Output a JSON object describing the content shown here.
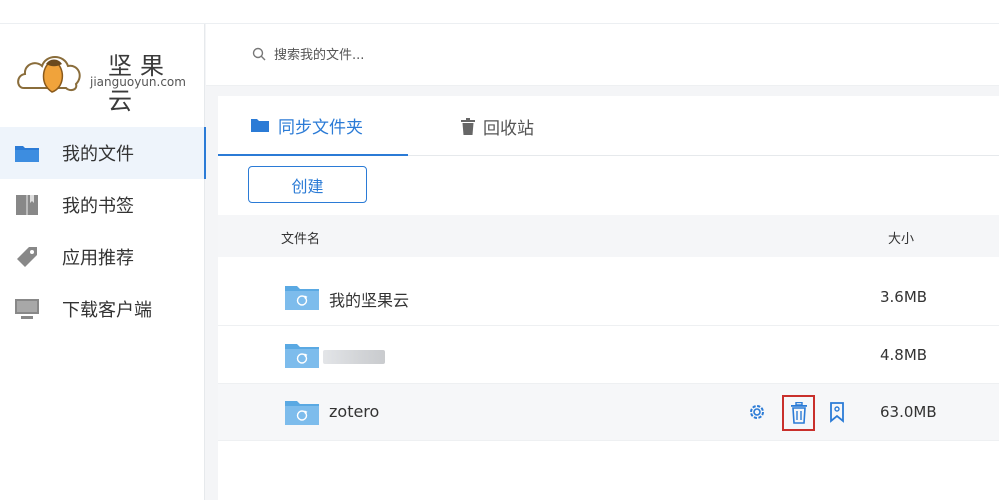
{
  "logo": {
    "name_cn": "坚果云",
    "name_en": "jianguoyun.com"
  },
  "sidebar": {
    "items": [
      {
        "label": "我的文件",
        "icon": "folder-icon",
        "active": true
      },
      {
        "label": "我的书签",
        "icon": "book-icon",
        "active": false
      },
      {
        "label": "应用推荐",
        "icon": "tag-icon",
        "active": false
      },
      {
        "label": "下载客户端",
        "icon": "monitor-icon",
        "active": false
      }
    ]
  },
  "search": {
    "placeholder": "搜索我的文件..."
  },
  "tabs": [
    {
      "label": "同步文件夹",
      "icon": "folder-icon",
      "active": true
    },
    {
      "label": "回收站",
      "icon": "trash-icon",
      "active": false
    }
  ],
  "toolbar": {
    "create_label": "创建"
  },
  "table": {
    "headers": {
      "name": "文件名",
      "size": "大小"
    },
    "rows": [
      {
        "name": "我的坚果云",
        "size": "3.6MB",
        "icon": "sync-folder-icon"
      },
      {
        "name": "",
        "size": "4.8MB",
        "icon": "sync-folder-icon",
        "name_obscured": true
      },
      {
        "name": "zotero",
        "size": "63.0MB",
        "icon": "sync-folder-icon",
        "hovered": true,
        "actions": [
          "gear-icon",
          "trash-icon",
          "bookmark-icon"
        ]
      }
    ]
  },
  "colors": {
    "accent": "#2b7bd6",
    "highlight_box": "#c9302c",
    "folder": "#6cb6e8"
  }
}
